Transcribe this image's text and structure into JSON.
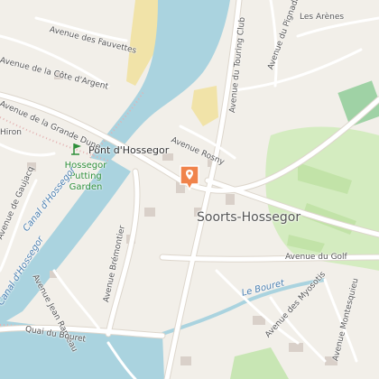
{
  "map": {
    "colors": {
      "land": "#f2efe9",
      "water": "#aad3df",
      "sand": "#f1e3a8",
      "golf": "#d4ecc0",
      "road": "#ffffff",
      "building": "#d9d0c9",
      "marker": "#f0834b",
      "poi_green": "#2f8f3a"
    },
    "place": "Soorts-Hossegor",
    "pont": "Pont d'Hossegor",
    "poi": {
      "icon": "golf-flag-icon",
      "line1": "Hossegor",
      "line2": "Putting",
      "line3": "Garden"
    },
    "canal": [
      "Canal d'Hossegor",
      "Canal d'Hossegor"
    ],
    "stream": "Le Bouret",
    "marker_icon": "location-marker-icon",
    "streets": [
      "Avenue des Fauvettes",
      "Avenue de la Côte d'Argent",
      "Avenue de la Grande Dune",
      "Avenue du Touring Club",
      "Les Arènes",
      "Avenue du Pignada",
      "Avenue Rosny",
      "Avenue de Gaujacq",
      "Avenue Brémontier",
      "Avenue Jean Rameau",
      "Avenue du Golf",
      "Avenue des Myosotis",
      "Avenue Montesquieu",
      "Quai du Bouret",
      "Hiron"
    ]
  }
}
